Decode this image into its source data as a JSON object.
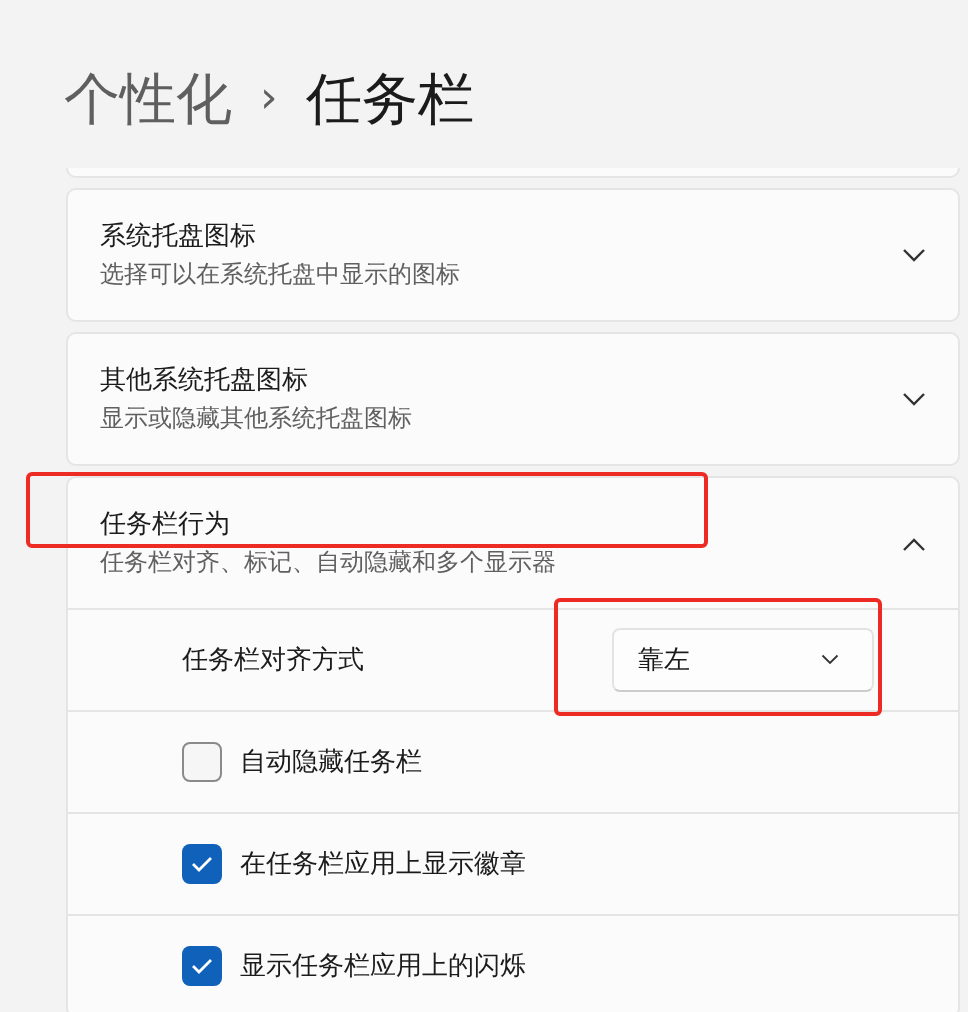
{
  "breadcrumb": {
    "parent": "个性化",
    "separator": "›",
    "current": "任务栏"
  },
  "sections": [
    {
      "title": "系统托盘图标",
      "subtitle": "选择可以在系统托盘中显示的图标",
      "expanded": false,
      "highlighted": false
    },
    {
      "title": "其他系统托盘图标",
      "subtitle": "显示或隐藏其他系统托盘图标",
      "expanded": false,
      "highlighted": false
    },
    {
      "title": "任务栏行为",
      "subtitle": "任务栏对齐、标记、自动隐藏和多个显示器",
      "expanded": true,
      "highlighted": true,
      "settings": [
        {
          "kind": "dropdown",
          "label": "任务栏对齐方式",
          "value": "靠左",
          "highlighted": true
        },
        {
          "kind": "checkbox",
          "label": "自动隐藏任务栏",
          "checked": false
        },
        {
          "kind": "checkbox",
          "label": "在任务栏应用上显示徽章",
          "checked": true
        },
        {
          "kind": "checkbox",
          "label": "显示任务栏应用上的闪烁",
          "checked": true
        }
      ]
    }
  ]
}
